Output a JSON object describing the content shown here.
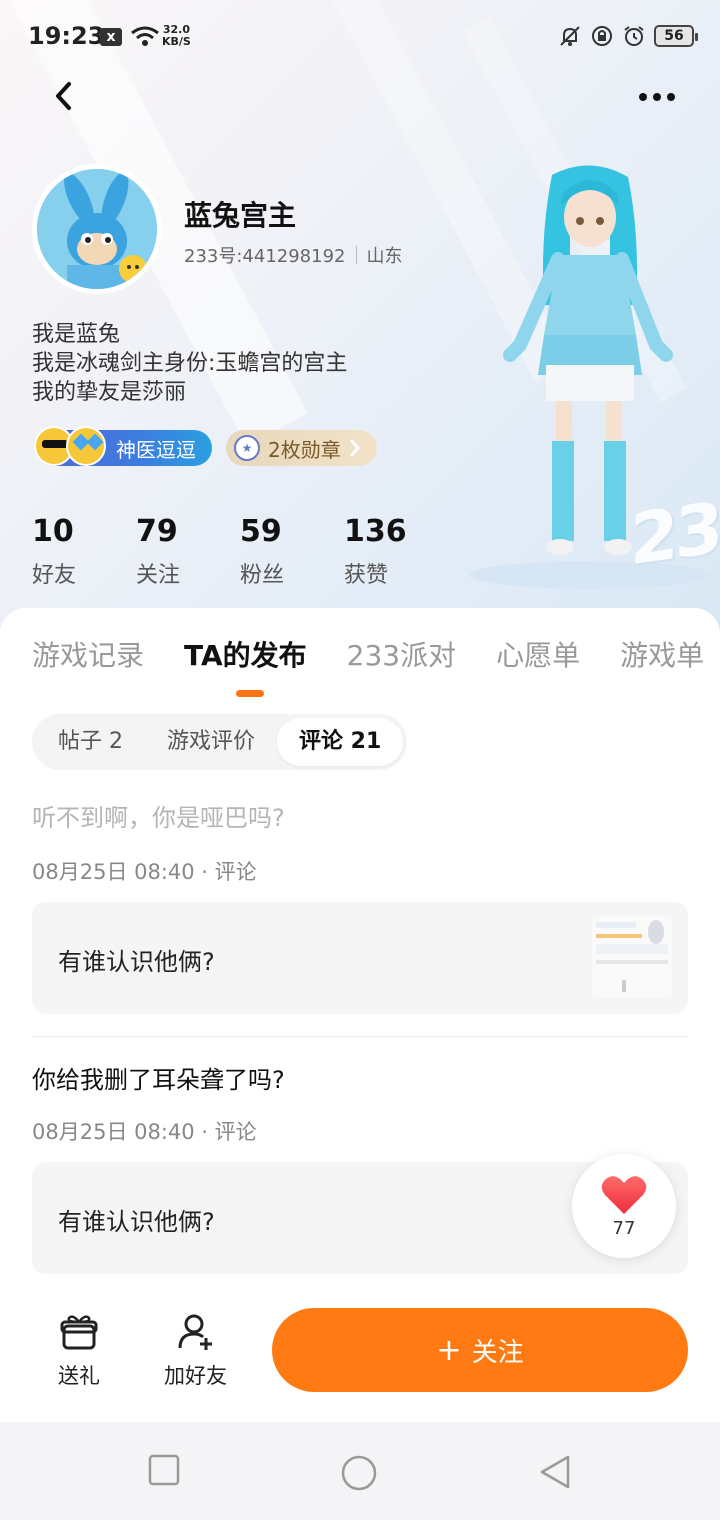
{
  "status_bar": {
    "time": "19:23",
    "notif_icon": "x",
    "speed_value": "32.0",
    "speed_unit": "KB/S",
    "battery": "56"
  },
  "profile": {
    "name": "蓝兔宫主",
    "id_text": "233号:441298192",
    "location": "山东",
    "bio": [
      "我是蓝兔",
      "我是冰魂剑主身份:玉蟾宫的宫主",
      "我的挚友是莎丽"
    ],
    "title_badge": "神医逗逗",
    "medal_badge": "2枚勋章",
    "stage_text": "233"
  },
  "stats": [
    {
      "value": "10",
      "label": "好友"
    },
    {
      "value": "79",
      "label": "关注"
    },
    {
      "value": "59",
      "label": "粉丝"
    },
    {
      "value": "136",
      "label": "获赞"
    }
  ],
  "tabs": [
    "游戏记录",
    "TA的发布",
    "233派对",
    "心愿单",
    "游戏单"
  ],
  "active_tab": "TA的发布",
  "subtabs": [
    "帖子 2",
    "游戏评价",
    "评论 21"
  ],
  "comments": [
    {
      "text": "听不到啊，你是哑巴吗?",
      "meta": "08月25日 08:40 · 评论",
      "quote": "有谁认识他俩?"
    },
    {
      "text": "你给我删了耳朵聋了吗?",
      "meta": "08月25日 08:40 · 评论",
      "quote": "有谁认识他俩?"
    }
  ],
  "like": {
    "count": "77"
  },
  "actions": {
    "gift": "送礼",
    "add_friend": "加好友",
    "follow": "关注"
  },
  "colors": {
    "accent": "#ff7a12",
    "panel_bg": "#ffffff",
    "title_badge": "#3b7de0"
  }
}
